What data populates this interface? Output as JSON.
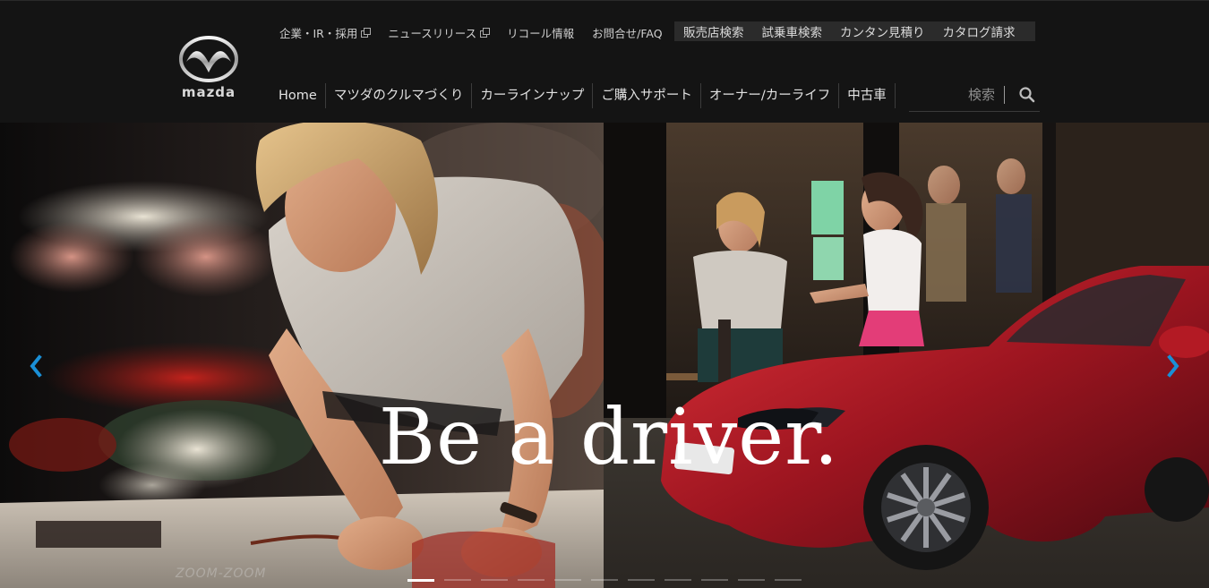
{
  "brand": {
    "wordmark": "mazda"
  },
  "util_links": [
    {
      "label": "企業・IR・採用",
      "external": true
    },
    {
      "label": "ニュースリリース",
      "external": true
    },
    {
      "label": "リコール情報",
      "external": false
    },
    {
      "label": "お問合せ/FAQ",
      "external": false
    }
  ],
  "util_buttons": [
    {
      "label": "販売店検索"
    },
    {
      "label": "試乗車検索"
    },
    {
      "label": "カンタン見積り"
    },
    {
      "label": "カタログ請求"
    }
  ],
  "main_nav": [
    {
      "label": "Home"
    },
    {
      "label": "マツダのクルマづくり"
    },
    {
      "label": "カーラインナップ"
    },
    {
      "label": "ご購入サポート"
    },
    {
      "label": "オーナー/カーライフ"
    },
    {
      "label": "中古車"
    }
  ],
  "search": {
    "placeholder": "検索",
    "icon": "search-icon"
  },
  "hero": {
    "headline": "Be a driver.",
    "watermark": "ZOOM-ZOOM",
    "slide_count": 11,
    "active_slide": 1,
    "prev_icon": "chevron-left-icon",
    "next_icon": "chevron-right-icon",
    "arrow_color": "#1a8fd6"
  }
}
